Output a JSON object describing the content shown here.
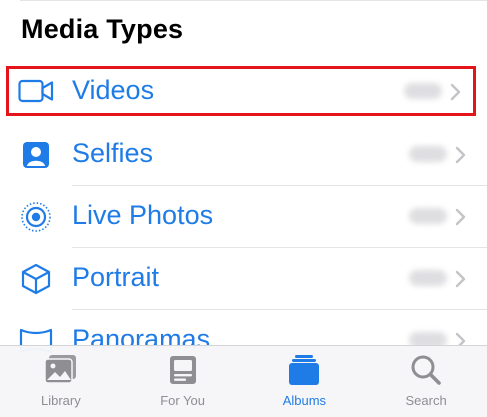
{
  "section": {
    "title": "Media Types"
  },
  "media_types": [
    {
      "label": "Videos",
      "icon": "video-camera-icon"
    },
    {
      "label": "Selfies",
      "icon": "selfie-portrait-icon"
    },
    {
      "label": "Live Photos",
      "icon": "live-photo-icon"
    },
    {
      "label": "Portrait",
      "icon": "cube-icon"
    },
    {
      "label": "Panoramas",
      "icon": "panorama-icon"
    }
  ],
  "tabbar": {
    "tabs": [
      {
        "label": "Library",
        "icon": "photo-library-icon",
        "active": false
      },
      {
        "label": "For You",
        "icon": "for-you-icon",
        "active": false
      },
      {
        "label": "Albums",
        "icon": "albums-icon",
        "active": true
      },
      {
        "label": "Search",
        "icon": "magnifier-icon",
        "active": false
      }
    ]
  },
  "colors": {
    "accent": "#1f7ce6",
    "inactive": "#8e8e93",
    "highlight": "#e5141a"
  }
}
